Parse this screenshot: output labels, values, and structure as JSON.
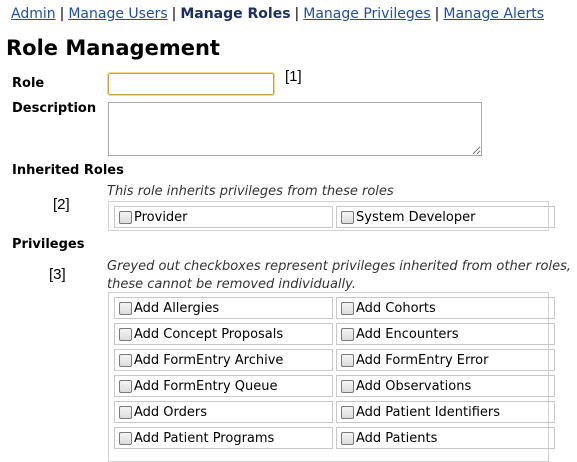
{
  "nav": {
    "items": [
      {
        "label": "Admin"
      },
      {
        "label": "Manage Users"
      },
      {
        "label": "Manage Roles"
      },
      {
        "label": "Manage Privileges"
      },
      {
        "label": "Manage Alerts"
      }
    ],
    "separator": "|"
  },
  "page_title": "Role Management",
  "form": {
    "role_label": "Role",
    "role_value": "",
    "description_label": "Description",
    "description_value": "",
    "inherited_label": "Inherited Roles",
    "inherited_note": "This role inherits privileges from these roles",
    "inherited_roles": [
      {
        "label": "Provider",
        "checked": false
      },
      {
        "label": "System Developer",
        "checked": false
      }
    ],
    "privileges_label": "Privileges",
    "privileges_note": "Greyed out checkboxes represent privileges inherited from other roles, these cannot be removed individually.",
    "privileges": [
      {
        "label": "Add Allergies",
        "checked": false
      },
      {
        "label": "Add Cohorts",
        "checked": false
      },
      {
        "label": "Add Concept Proposals",
        "checked": false
      },
      {
        "label": "Add Encounters",
        "checked": false
      },
      {
        "label": "Add FormEntry Archive",
        "checked": false
      },
      {
        "label": "Add FormEntry Error",
        "checked": false
      },
      {
        "label": "Add FormEntry Queue",
        "checked": false
      },
      {
        "label": "Add Observations",
        "checked": false
      },
      {
        "label": "Add Orders",
        "checked": false
      },
      {
        "label": "Add Patient Identifiers",
        "checked": false
      },
      {
        "label": "Add Patient Programs",
        "checked": false
      },
      {
        "label": "Add Patients",
        "checked": false
      }
    ]
  },
  "markers": {
    "m1": "[1]",
    "m2": "[2]",
    "m3": "[3]"
  },
  "colors": {
    "link": "#1f4fa0",
    "current_link": "#1a2f66",
    "focus_border": "#c9a447"
  }
}
